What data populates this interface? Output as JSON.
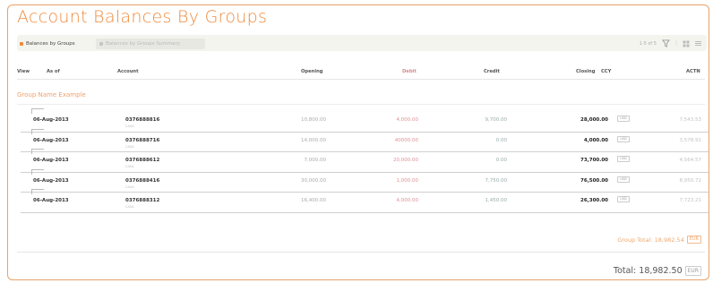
{
  "page": {
    "title": "Account Balances By Groups",
    "tabs": [
      {
        "label": "Balances by Groups"
      },
      {
        "label": "Balances by Groups Summary"
      }
    ],
    "pager_text": "1-5 of 5"
  },
  "table": {
    "headers": {
      "view": "View",
      "as_of": "As of",
      "account": "Account",
      "opening": "Opening",
      "debit": "Debit",
      "credit": "Credit",
      "closing": "Closing",
      "ccy": "CCY",
      "actions": "ACTN"
    },
    "group_label": "Group Name Example",
    "rows": [
      {
        "date": "06-Aug-2013",
        "account": "0376888816",
        "sub": "CASA",
        "opening": "10,800.00",
        "debit": "4,000.00",
        "credit": "9,700.00",
        "closing": "28,000.00",
        "ccy": "USD",
        "trail": "7,543.53"
      },
      {
        "date": "06-Aug-2013",
        "account": "0376888716",
        "sub": "CASA",
        "opening": "14,000.00",
        "debit": "40000.00",
        "credit": "0.00",
        "closing": "4,000.00",
        "ccy": "USD",
        "trail": "3,578.91"
      },
      {
        "date": "06-Aug-2013",
        "account": "0376888612",
        "sub": "CASA",
        "opening": "7,000.00",
        "debit": "20,000.00",
        "credit": "0.00",
        "closing": "73,700.00",
        "ccy": "USD",
        "trail": "4,564.57"
      },
      {
        "date": "06-Aug-2013",
        "account": "0376888416",
        "sub": "CASA",
        "opening": "30,000.00",
        "debit": "1,000.00",
        "credit": "7,750.00",
        "closing": "76,500.00",
        "ccy": "USD",
        "trail": "8,950.72"
      },
      {
        "date": "06-Aug-2013",
        "account": "0376888312",
        "sub": "CASA",
        "opening": "16,400.00",
        "debit": "4,000.00",
        "credit": "1,450.00",
        "closing": "26,300.00",
        "ccy": "USD",
        "trail": "7,723.21"
      }
    ]
  },
  "totals": {
    "group_total_text": "Group Total: 18,982.54",
    "group_ccy": "EUR",
    "grand_total_text": "Total: 18,982.50",
    "grand_ccy": "EUR"
  },
  "colors": {
    "accent": "#ee8a3c",
    "debit_text": "#e09096",
    "frame_border": "#e8a36a"
  },
  "icons": [
    "tab-marker-icon",
    "filter-icon",
    "grid-view-icon",
    "menu-icon"
  ]
}
